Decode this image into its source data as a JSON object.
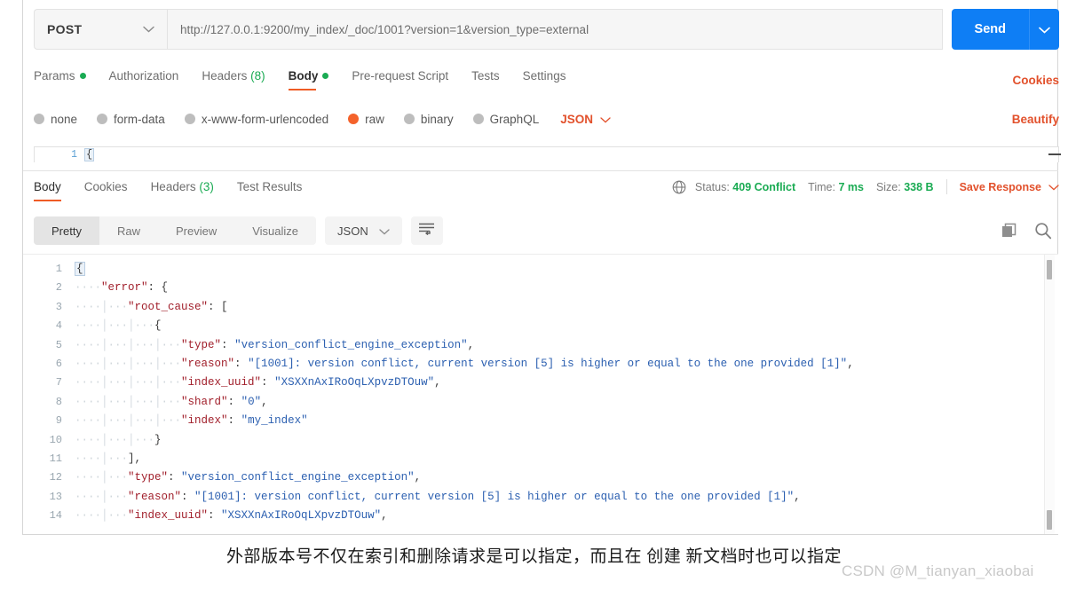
{
  "request": {
    "method": "POST",
    "url": "http://127.0.0.1:9200/my_index/_doc/1001?version=1&version_type=external",
    "send_label": "Send",
    "tabs": [
      {
        "label": "Params",
        "marker": "dot",
        "active": false
      },
      {
        "label": "Authorization",
        "marker": "",
        "active": false
      },
      {
        "label": "Headers",
        "marker": "count",
        "count": "(8)",
        "active": false
      },
      {
        "label": "Body",
        "marker": "dot",
        "active": true
      },
      {
        "label": "Pre-request Script",
        "marker": "",
        "active": false
      },
      {
        "label": "Tests",
        "marker": "",
        "active": false
      },
      {
        "label": "Settings",
        "marker": "",
        "active": false
      }
    ],
    "cookies_label": "Cookies",
    "beautify_label": "Beautify",
    "body_types": [
      {
        "label": "none",
        "selected": false
      },
      {
        "label": "form-data",
        "selected": false
      },
      {
        "label": "x-www-form-urlencoded",
        "selected": false
      },
      {
        "label": "raw",
        "selected": true
      },
      {
        "label": "binary",
        "selected": false
      },
      {
        "label": "GraphQL",
        "selected": false
      }
    ],
    "body_format": "JSON",
    "editor_line_number": "1",
    "editor_text": "{"
  },
  "response": {
    "tabs": [
      {
        "label": "Body",
        "marker": "",
        "active": true
      },
      {
        "label": "Cookies",
        "marker": "",
        "active": false
      },
      {
        "label": "Headers",
        "marker": "count",
        "count": "(3)",
        "active": false
      },
      {
        "label": "Test Results",
        "marker": "",
        "active": false
      }
    ],
    "status_label": "Status:",
    "status_value": "409 Conflict",
    "time_label": "Time:",
    "time_value": "7 ms",
    "size_label": "Size:",
    "size_value": "338 B",
    "save_response_label": "Save Response",
    "view_modes": [
      {
        "label": "Pretty",
        "active": true
      },
      {
        "label": "Raw",
        "active": false
      },
      {
        "label": "Preview",
        "active": false
      },
      {
        "label": "Visualize",
        "active": false
      }
    ],
    "format": "JSON",
    "body_lines": [
      {
        "n": "1",
        "indent": 0,
        "tokens": [
          {
            "t": "brace",
            "s": "{"
          }
        ]
      },
      {
        "n": "2",
        "indent": 1,
        "tokens": [
          {
            "t": "k",
            "s": "\"error\""
          },
          {
            "t": "p",
            "s": ": {"
          }
        ]
      },
      {
        "n": "3",
        "indent": 2,
        "tokens": [
          {
            "t": "k",
            "s": "\"root_cause\""
          },
          {
            "t": "p",
            "s": ": ["
          }
        ]
      },
      {
        "n": "4",
        "indent": 3,
        "tokens": [
          {
            "t": "p",
            "s": "{"
          }
        ]
      },
      {
        "n": "5",
        "indent": 4,
        "tokens": [
          {
            "t": "k",
            "s": "\"type\""
          },
          {
            "t": "p",
            "s": ": "
          },
          {
            "t": "v",
            "s": "\"version_conflict_engine_exception\""
          },
          {
            "t": "p",
            "s": ","
          }
        ]
      },
      {
        "n": "6",
        "indent": 4,
        "tokens": [
          {
            "t": "k",
            "s": "\"reason\""
          },
          {
            "t": "p",
            "s": ": "
          },
          {
            "t": "v",
            "s": "\"[1001]: version conflict, current version [5] is higher or equal to the one provided [1]\""
          },
          {
            "t": "p",
            "s": ","
          }
        ]
      },
      {
        "n": "7",
        "indent": 4,
        "tokens": [
          {
            "t": "k",
            "s": "\"index_uuid\""
          },
          {
            "t": "p",
            "s": ": "
          },
          {
            "t": "v",
            "s": "\"XSXXnAxIRoOqLXpvzDTOuw\""
          },
          {
            "t": "p",
            "s": ","
          }
        ]
      },
      {
        "n": "8",
        "indent": 4,
        "tokens": [
          {
            "t": "k",
            "s": "\"shard\""
          },
          {
            "t": "p",
            "s": ": "
          },
          {
            "t": "v",
            "s": "\"0\""
          },
          {
            "t": "p",
            "s": ","
          }
        ]
      },
      {
        "n": "9",
        "indent": 4,
        "tokens": [
          {
            "t": "k",
            "s": "\"index\""
          },
          {
            "t": "p",
            "s": ": "
          },
          {
            "t": "v",
            "s": "\"my_index\""
          }
        ]
      },
      {
        "n": "10",
        "indent": 3,
        "tokens": [
          {
            "t": "p",
            "s": "}"
          }
        ]
      },
      {
        "n": "11",
        "indent": 2,
        "tokens": [
          {
            "t": "p",
            "s": "],"
          }
        ]
      },
      {
        "n": "12",
        "indent": 2,
        "tokens": [
          {
            "t": "k",
            "s": "\"type\""
          },
          {
            "t": "p",
            "s": ": "
          },
          {
            "t": "v",
            "s": "\"version_conflict_engine_exception\""
          },
          {
            "t": "p",
            "s": ","
          }
        ]
      },
      {
        "n": "13",
        "indent": 2,
        "tokens": [
          {
            "t": "k",
            "s": "\"reason\""
          },
          {
            "t": "p",
            "s": ": "
          },
          {
            "t": "v",
            "s": "\"[1001]: version conflict, current version [5] is higher or equal to the one provided [1]\""
          },
          {
            "t": "p",
            "s": ","
          }
        ]
      },
      {
        "n": "14",
        "indent": 2,
        "tokens": [
          {
            "t": "k",
            "s": "\"index_uuid\""
          },
          {
            "t": "p",
            "s": ": "
          },
          {
            "t": "v",
            "s": "\"XSXXnAxIRoOqLXpvzDTOuw\""
          },
          {
            "t": "p",
            "s": ","
          }
        ]
      }
    ]
  },
  "caption": {
    "text": "外部版本号不仅在索引和删除请求是可以指定，而且在 创建 新文档时也可以指定",
    "watermark": "CSDN @M_tianyan_xiaobai"
  }
}
